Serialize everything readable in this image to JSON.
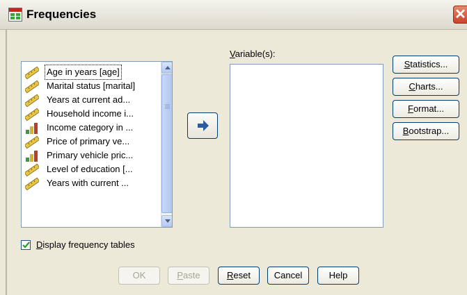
{
  "window": {
    "title": "Frequencies",
    "close_glyph": "✕"
  },
  "variables_list": {
    "items": [
      {
        "label": "Age in years [age]",
        "icon": "scale-ruler-icon",
        "selected": true
      },
      {
        "label": "Marital status [marital]",
        "icon": "scale-ruler-icon"
      },
      {
        "label": "Years at current ad...",
        "icon": "scale-ruler-icon"
      },
      {
        "label": "Household income i...",
        "icon": "scale-ruler-icon"
      },
      {
        "label": "Income category in ...",
        "icon": "ordinal-bars-icon"
      },
      {
        "label": "Price of primary ve...",
        "icon": "scale-ruler-icon"
      },
      {
        "label": "Primary vehicle pric...",
        "icon": "ordinal-bars-icon"
      },
      {
        "label": "Level of education [...",
        "icon": "scale-ruler-icon"
      },
      {
        "label": "Years with current ...",
        "icon": "scale-ruler-icon"
      }
    ]
  },
  "target": {
    "label_underlined": "V",
    "label_rest": "ariable(s):"
  },
  "side_buttons": {
    "statistics": {
      "u": "S",
      "rest": "tatistics..."
    },
    "charts": {
      "u": "C",
      "rest": "harts..."
    },
    "format": {
      "u": "F",
      "rest": "ormat..."
    },
    "bootstrap": {
      "u": "B",
      "rest": "ootstrap..."
    }
  },
  "checkbox": {
    "u": "D",
    "rest": "isplay frequency tables",
    "checked": true
  },
  "bottom_buttons": {
    "ok": "OK",
    "paste_u": "P",
    "paste_rest": "aste",
    "reset_u": "R",
    "reset_rest": "eset",
    "cancel": "Cancel",
    "help": "Help"
  },
  "colors": {
    "title_bg": "#ece9d8",
    "accent_blue": "#316ac5",
    "close_red": "#c8432a"
  }
}
